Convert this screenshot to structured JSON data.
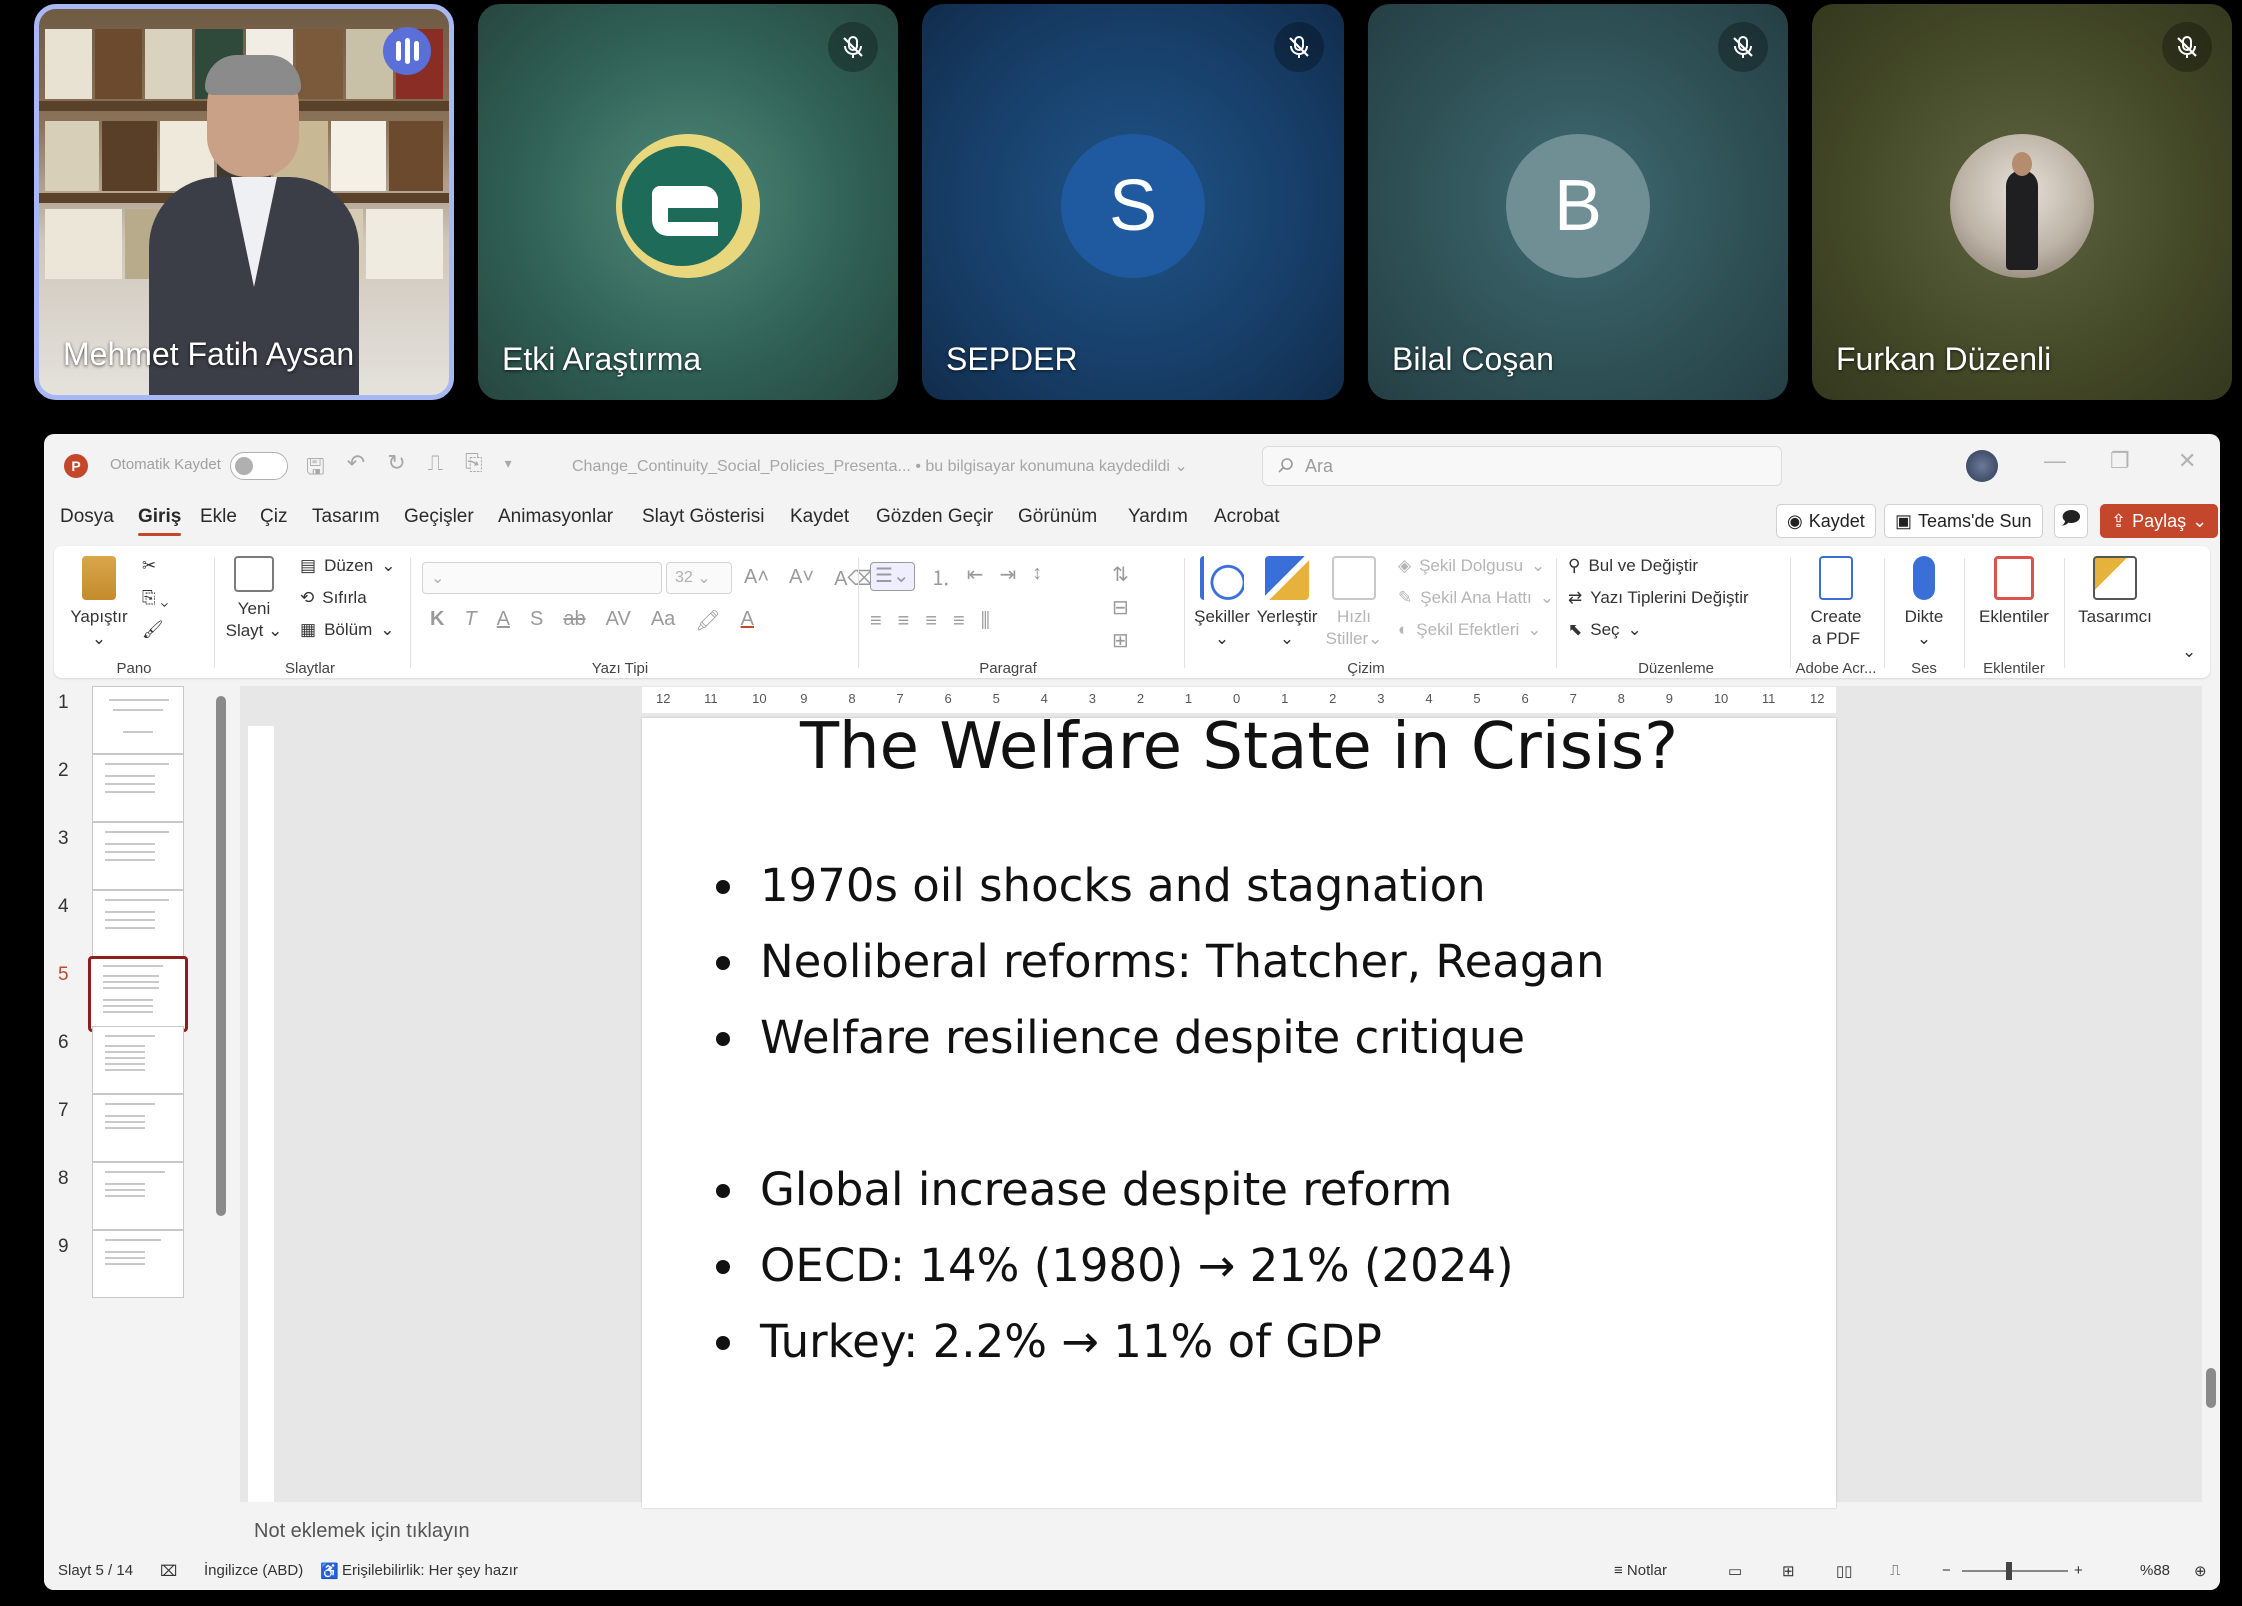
{
  "participants": [
    {
      "name": "Mehmet Fatih Aysan",
      "state": "speaking",
      "kind": "video"
    },
    {
      "name": "Etki Araştırma",
      "state": "muted",
      "kind": "logo"
    },
    {
      "name": "SEPDER",
      "state": "muted",
      "kind": "initial",
      "initial": "S",
      "color": "#1f5aa0"
    },
    {
      "name": "Bilal Coşan",
      "state": "muted",
      "kind": "initial",
      "initial": "B",
      "color": "#6f8f95"
    },
    {
      "name": "Furkan Düzenli",
      "state": "muted",
      "kind": "photo"
    }
  ],
  "titlebar": {
    "autosave_label": "Otomatik Kaydet",
    "doc_name": "Change_Continuity_Social_Policies_Presenta...",
    "save_location": "• bu bilgisayar konumuna kaydedildi",
    "search_placeholder": "Ara"
  },
  "tabs": [
    "Dosya",
    "Giriş",
    "Ekle",
    "Çiz",
    "Tasarım",
    "Geçişler",
    "Animasyonlar",
    "Slayt Gösterisi",
    "Kaydet",
    "Gözden Geçir",
    "Görünüm",
    "Yardım",
    "Acrobat"
  ],
  "active_tab": "Giriş",
  "right_buttons": {
    "record": "Kaydet",
    "teams": "Teams'de Sun",
    "share": "Paylaş"
  },
  "ribbon": {
    "pano": {
      "paste": "Yapıştır",
      "label": "Pano"
    },
    "slaytlar": {
      "new_slide_1": "Yeni",
      "new_slide_2": "Slayt",
      "layout": "Düzen",
      "reset": "Sıfırla",
      "section": "Bölüm",
      "label": "Slaytlar"
    },
    "font": {
      "size": "32",
      "label": "Yazı Tipi",
      "bold": "K",
      "italic": "T",
      "underline": "A",
      "shadow": "S",
      "strike": "ab",
      "spacing": "AV",
      "case": "Aa"
    },
    "paragraph": {
      "label": "Paragraf"
    },
    "drawing": {
      "shapes": "Şekiller",
      "arrange": "Yerleştir",
      "quick_styles_1": "Hızlı",
      "quick_styles_2": "Stiller",
      "fill": "Şekil Dolgusu",
      "outline": "Şekil Ana Hattı",
      "effects": "Şekil Efektleri",
      "label": "Çizim"
    },
    "editing": {
      "find": "Bul ve Değiştir",
      "replace_fonts": "Yazı Tiplerini Değiştir",
      "select": "Seç",
      "label": "Düzenleme"
    },
    "adobe": {
      "create_1": "Create",
      "create_2": "a PDF",
      "label": "Adobe Acr..."
    },
    "voice": {
      "dictate": "Dikte",
      "label": "Ses"
    },
    "addins": {
      "addins": "Eklentiler",
      "label": "Eklentiler"
    },
    "designer": {
      "designer": "Tasarımcı"
    }
  },
  "thumbnails": [
    {
      "num": "1",
      "title": "Change, Continuity Social Policies in Turkish Reform"
    },
    {
      "num": "2",
      "title": "Why Social Policy Matters Today"
    },
    {
      "num": "3",
      "title": "Foundations of the Welfare State"
    },
    {
      "num": "4",
      "title": "The Golden Age of Welfare"
    },
    {
      "num": "5",
      "title": "The Welfare State in Crisis?"
    },
    {
      "num": "6",
      "title": "Emerging Global Challenges"
    },
    {
      "num": "7",
      "title": "Transformation Era"
    },
    {
      "num": "8",
      "title": "Comparative Welfare Models"
    },
    {
      "num": "9",
      "title": "Aging, Migration, and Welfare"
    }
  ],
  "selected_slide": 5,
  "slide": {
    "title": "The Welfare State in Crisis?",
    "bullets": [
      "1970s oil shocks and stagnation",
      "Neoliberal reforms: Thatcher, Reagan",
      "Welfare resilience despite critique",
      "",
      "Global increase despite reform",
      "OECD: 14% (1980) → 21% (2024)",
      "Turkey: 2.2% → 11% of GDP"
    ]
  },
  "ruler_ticks": [
    "12",
    "11",
    "10",
    "9",
    "8",
    "7",
    "6",
    "5",
    "4",
    "3",
    "2",
    "1",
    "0",
    "1",
    "2",
    "3",
    "4",
    "5",
    "6",
    "7",
    "8",
    "9",
    "10",
    "11",
    "12"
  ],
  "notes_placeholder": "Not eklemek için tıklayın",
  "status": {
    "slide_pos": "Slayt 5 / 14",
    "language": "İngilizce (ABD)",
    "accessibility": "Erişilebilirlik: Her şey hazır",
    "notes": "Notlar",
    "zoom": "%88"
  }
}
